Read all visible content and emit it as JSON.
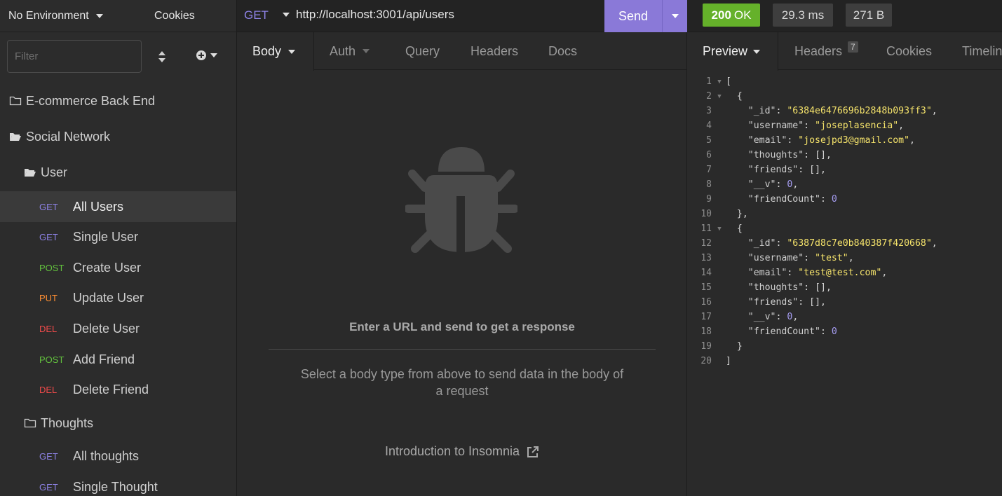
{
  "sidebar": {
    "environment": "No Environment",
    "cookies": "Cookies",
    "filter_placeholder": "Filter",
    "tree": [
      {
        "kind": "folder",
        "open": false,
        "label": "E-commerce Back End",
        "level": 0
      },
      {
        "kind": "folder",
        "open": true,
        "label": "Social Network",
        "level": 0
      },
      {
        "kind": "folder",
        "open": true,
        "label": "User",
        "level": 1
      },
      {
        "kind": "request",
        "method": "GET",
        "label": "All Users",
        "selected": true
      },
      {
        "kind": "request",
        "method": "GET",
        "label": "Single User"
      },
      {
        "kind": "request",
        "method": "POST",
        "label": "Create User"
      },
      {
        "kind": "request",
        "method": "PUT",
        "label": "Update User"
      },
      {
        "kind": "request",
        "method": "DEL",
        "label": "Delete User"
      },
      {
        "kind": "request",
        "method": "POST",
        "label": "Add Friend"
      },
      {
        "kind": "request",
        "method": "DEL",
        "label": "Delete Friend"
      },
      {
        "kind": "folder",
        "open": false,
        "label": "Thoughts",
        "level": 1
      },
      {
        "kind": "request",
        "method": "GET",
        "label": "All thoughts"
      },
      {
        "kind": "request",
        "method": "GET",
        "label": "Single Thought"
      }
    ]
  },
  "request": {
    "method": "GET",
    "url": "http://localhost:3001/api/users",
    "send_label": "Send",
    "tabs": [
      "Body",
      "Auth",
      "Query",
      "Headers",
      "Docs"
    ],
    "empty_title": "Enter a URL and send to get a response",
    "empty_subtitle": "Select a body type from above to send data in the body of a request",
    "intro_link": "Introduction to Insomnia"
  },
  "response": {
    "status_code": "200",
    "status_text": "OK",
    "time": "29.3 ms",
    "size": "271 B",
    "tabs": {
      "preview": "Preview",
      "headers": "Headers",
      "headers_count": "7",
      "cookies": "Cookies",
      "timeline": "Timeline"
    },
    "body": [
      {
        "_id": "6384e6476696b2848b093ff3",
        "username": "joseplasencia",
        "email": "josejpd3@gmail.com",
        "thoughts": [],
        "friends": [],
        "__v": 0,
        "friendCount": 0
      },
      {
        "_id": "6387d8c7e0b840387f420668",
        "username": "test",
        "email": "test@test.com",
        "thoughts": [],
        "friends": [],
        "__v": 0,
        "friendCount": 0
      }
    ]
  },
  "colors": {
    "method_get": "#8d82e6",
    "method_post": "#63c23e",
    "method_put": "#ff8f33",
    "method_del": "#ef4a4a",
    "send_button": "#8a79d8",
    "status_ok": "#65b12a"
  }
}
